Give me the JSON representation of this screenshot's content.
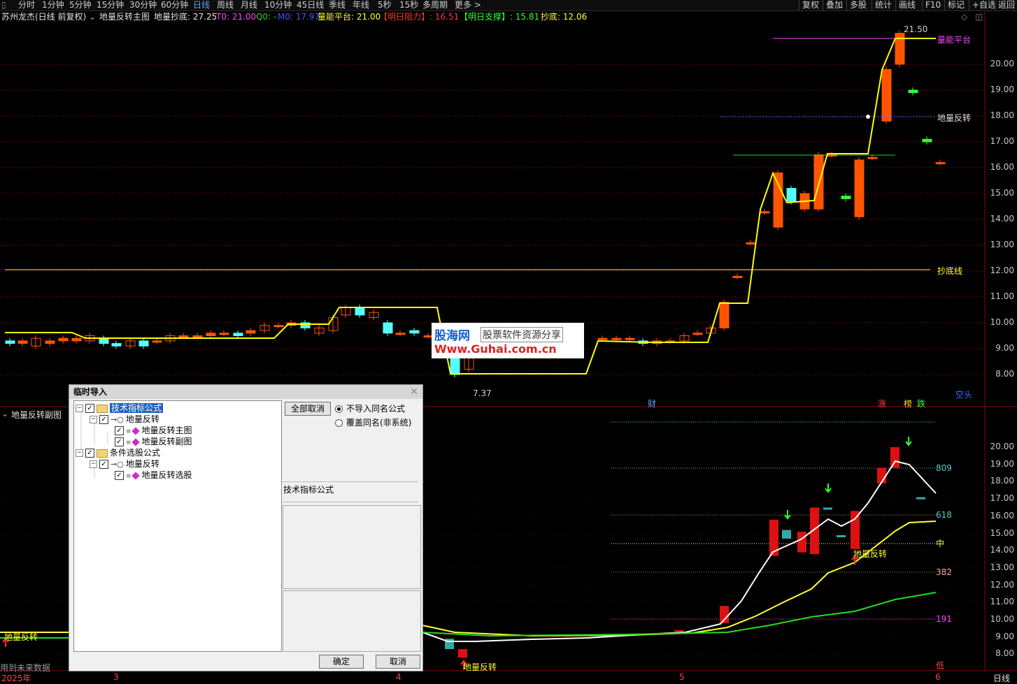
{
  "toolbar": {
    "periods": [
      "分时",
      "1分钟",
      "5分钟",
      "15分钟",
      "30分钟",
      "60分钟",
      "日线",
      "周线",
      "月线",
      "10分钟",
      "45日线",
      "季线",
      "年线",
      "5秒",
      "15秒",
      "多周期",
      "更多 >"
    ],
    "active_period": "日线",
    "right": [
      "复权",
      "叠加",
      "多股",
      "统计",
      "画线",
      "F10",
      "标记",
      "+自选",
      "返回"
    ]
  },
  "info_bar": {
    "stock": "苏州龙杰(日线 前复权)",
    "indicator": "地量反转主图",
    "items": [
      {
        "text": "地量抄底: 27.25",
        "color": "#e8e8e8"
      },
      {
        "text": "T0: 21.00",
        "color": "#ff44ff"
      },
      {
        "text": "Q0: -",
        "color": "#33cc33"
      },
      {
        "text": "M0: 17.97",
        "color": "#3f59ff"
      },
      {
        "text": "量能平台: 21.00",
        "color": "#ffff33"
      },
      {
        "text": "【明日阻力】: 16.51",
        "color": "#ff3333"
      },
      {
        "text": "【明日支撑】: 15.81",
        "color": "#33ff33"
      },
      {
        "text": "抄底: 12.06",
        "color": "#ffff33"
      }
    ]
  },
  "main_chart": {
    "y_labels": [
      "20.00",
      "19.00",
      "18.00",
      "17.00",
      "16.00",
      "15.00",
      "14.00",
      "13.00",
      "12.00",
      "11.00",
      "10.00",
      "9.00",
      "8.00"
    ],
    "annotations": {
      "high": "21.50",
      "low": "7.37",
      "platform": "量能平台",
      "reversal": "地量反转",
      "bottom_line": "抄底线",
      "cai": "财",
      "zhang": "涨",
      "bang": "榜",
      "die": "跌",
      "kongtou": "空头"
    }
  },
  "sub_chart": {
    "title": "地量反转副图",
    "y_labels": [
      "20.00",
      "19.00",
      "18.00",
      "17.00",
      "16.00",
      "15.00",
      "14.00",
      "13.00",
      "12.00",
      "11.00",
      "10.00",
      "9.00",
      "8.00"
    ],
    "fib_labels": [
      "809",
      "618",
      "中",
      "382",
      "191",
      "低"
    ],
    "reversal_label": "地量反转",
    "left_labels": [
      "地量反转",
      "用到未来数据"
    ]
  },
  "x_axis": {
    "labels": [
      "2025年",
      "3",
      "4",
      "5",
      "6"
    ],
    "period_label": "日线"
  },
  "watermark": {
    "brand": "股海网",
    "tagline": "股票软件资源分享",
    "url": "Www.Guhai.com.cn"
  },
  "dialog": {
    "title": "临时导入",
    "tree": [
      {
        "label": "技术指标公式",
        "level": 0,
        "type": "folder",
        "selected": true
      },
      {
        "label": "地量反转",
        "level": 1,
        "type": "key"
      },
      {
        "label": "地量反转主图",
        "level": 2,
        "type": "formula"
      },
      {
        "label": "地量反转副图",
        "level": 2,
        "type": "formula"
      },
      {
        "label": "条件选股公式",
        "level": 0,
        "type": "folder",
        "selected": false
      },
      {
        "label": "地量反转",
        "level": 1,
        "type": "key"
      },
      {
        "label": "地量反转选股",
        "level": 2,
        "type": "formula"
      }
    ],
    "cancel_all": "全部取消",
    "options": [
      "不导入同名公式",
      "覆盖同名(非系统)"
    ],
    "selected_option": 0,
    "type_label": "技术指标公式",
    "ok": "确定",
    "cancel": "取消"
  },
  "colors": {
    "up": "#ff5500",
    "down": "#55ffff",
    "gold": "#ffd700",
    "grid": "#8b0000"
  }
}
